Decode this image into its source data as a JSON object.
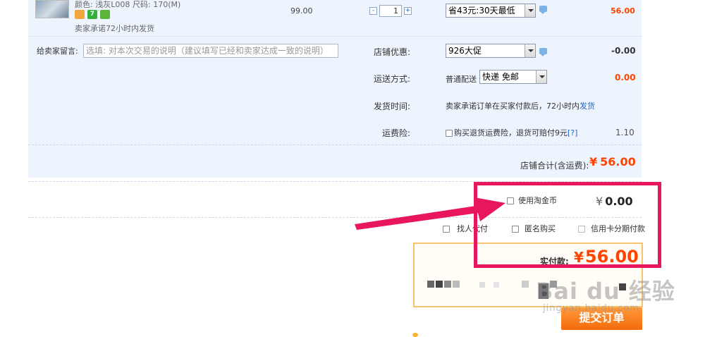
{
  "item": {
    "color_label": "颜色: 浅灰L008",
    "size_label": "尺码: 170(M)",
    "promise": "卖家承诺72小时内发货",
    "price": "99.00",
    "quantity": "1",
    "discount_option": "省43元:30天最低",
    "subtotal": "56.00"
  },
  "remark": {
    "label": "给卖家留言:",
    "placeholder": "选填: 对本次交易的说明（建议填写已经和卖家达成一致的说明）"
  },
  "shop_promo": {
    "label": "店铺优惠:",
    "option": "926大促",
    "value": "-0.00"
  },
  "shipping": {
    "label": "运送方式:",
    "type": "普通配送",
    "option": "快递 免邮",
    "value": "0.00"
  },
  "ship_time": {
    "label": "发货时间:",
    "text": "卖家承诺订单在买家付款后，72小时内",
    "link": "发货"
  },
  "insurance": {
    "label": "运费险:",
    "text": "购买退货运费险，退货可赔付9元",
    "help": "[?]",
    "value": "1.10"
  },
  "shop_total": {
    "label": "店铺合计(含运费):",
    "currency": "¥",
    "value": "56.00"
  },
  "coins": {
    "label": "使用淘金币",
    "currency": "¥",
    "value": "0.00"
  },
  "options": {
    "friend_pay": "找人代付",
    "anonymous": "匿名购买",
    "installment": "信用卡分期付款"
  },
  "payment": {
    "label": "实付款:",
    "currency": "¥",
    "value": "56.00"
  },
  "submit_label": "提交订单",
  "watermark": {
    "main": "Bai du 经验",
    "sub": "jingyan.baidu.com"
  },
  "colors": {
    "accent": "#f40",
    "highlight": "#e8175d",
    "panel": "#edf4fd"
  }
}
